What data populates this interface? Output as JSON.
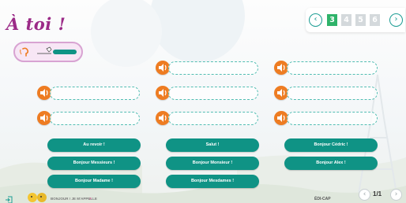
{
  "title": "À toi !",
  "pager": {
    "prev_icon": "chevron-left-icon",
    "next_icon": "chevron-right-icon",
    "pages": [
      "3",
      "4",
      "5",
      "6"
    ],
    "active_color": "#2fb36a",
    "inactive_color": "#d4d9dc"
  },
  "chips": {
    "au_revoir": "Au revoir !",
    "salut": "Salut !",
    "bonjour_cedric": "Bonjour Cédric !",
    "bonjour_messieurs": "Bonjour Messieurs !",
    "bonjour_monsieur": "Bonjour Monsieur !",
    "bonjour_alex": "Bonjour Alex !",
    "bonjour_madame": "Bonjour Madame !",
    "bonjour_mesdames": "Bonjour Mesdames !"
  },
  "footer": {
    "lesson_title": "BONJOUR ! JE M'APPELLE",
    "arrow": ">",
    "brand": "ÉDI-CAP",
    "page_count": "1/1"
  },
  "colors": {
    "accent": "#0f9385",
    "speaker": "#ee7c22",
    "title": "#9b2a87"
  }
}
